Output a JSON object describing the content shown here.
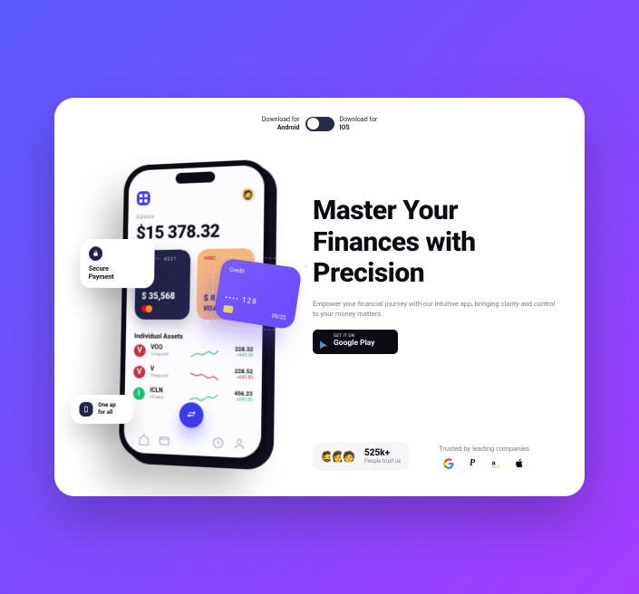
{
  "toggle": {
    "left_label_l1": "Download for",
    "left_label_l2": "Android",
    "right_label_l1": "Download for",
    "right_label_l2": "IOS"
  },
  "headline": "Master Your\nFinances with\nPrecision",
  "subhead": "Empower your financial journey with our intuitive app, bringing clarity and control to your money matters.",
  "play": {
    "line1": "GET IT ON",
    "line2": "Google Play"
  },
  "trust": {
    "count": "525k+",
    "sub": "People trust us"
  },
  "companies_label": "Trusted by leading companies",
  "phone": {
    "balance_label": "Balance",
    "balance_value": "$15 378.32",
    "card1": {
      "dots": "•••• •••• 4221",
      "amount": "$ 35,568"
    },
    "card2": {
      "bank": "HSBC",
      "amount": "$ 8,...",
      "brand": "VISA"
    },
    "section_title": "Individual Assets",
    "assets": [
      {
        "ticker": "VOO",
        "sub": "Vanguard",
        "value": "228.32",
        "pct": "+643.59",
        "pct_class": "pct-green"
      },
      {
        "ticker": "V",
        "sub": "Vanguard",
        "value": "228.52",
        "pct": "+643.59",
        "pct_class": "pct-red"
      },
      {
        "ticker": "ICLN",
        "sub": "iShares",
        "value": "456.23",
        "pct": "+643.59",
        "pct_class": "pct-green"
      }
    ]
  },
  "float_secure": "Secure\nPayment",
  "float_credit": {
    "label": "Credit",
    "number": "•••• 128",
    "expiry": "09/25"
  },
  "float_oneapp": "One ap\nfor all"
}
